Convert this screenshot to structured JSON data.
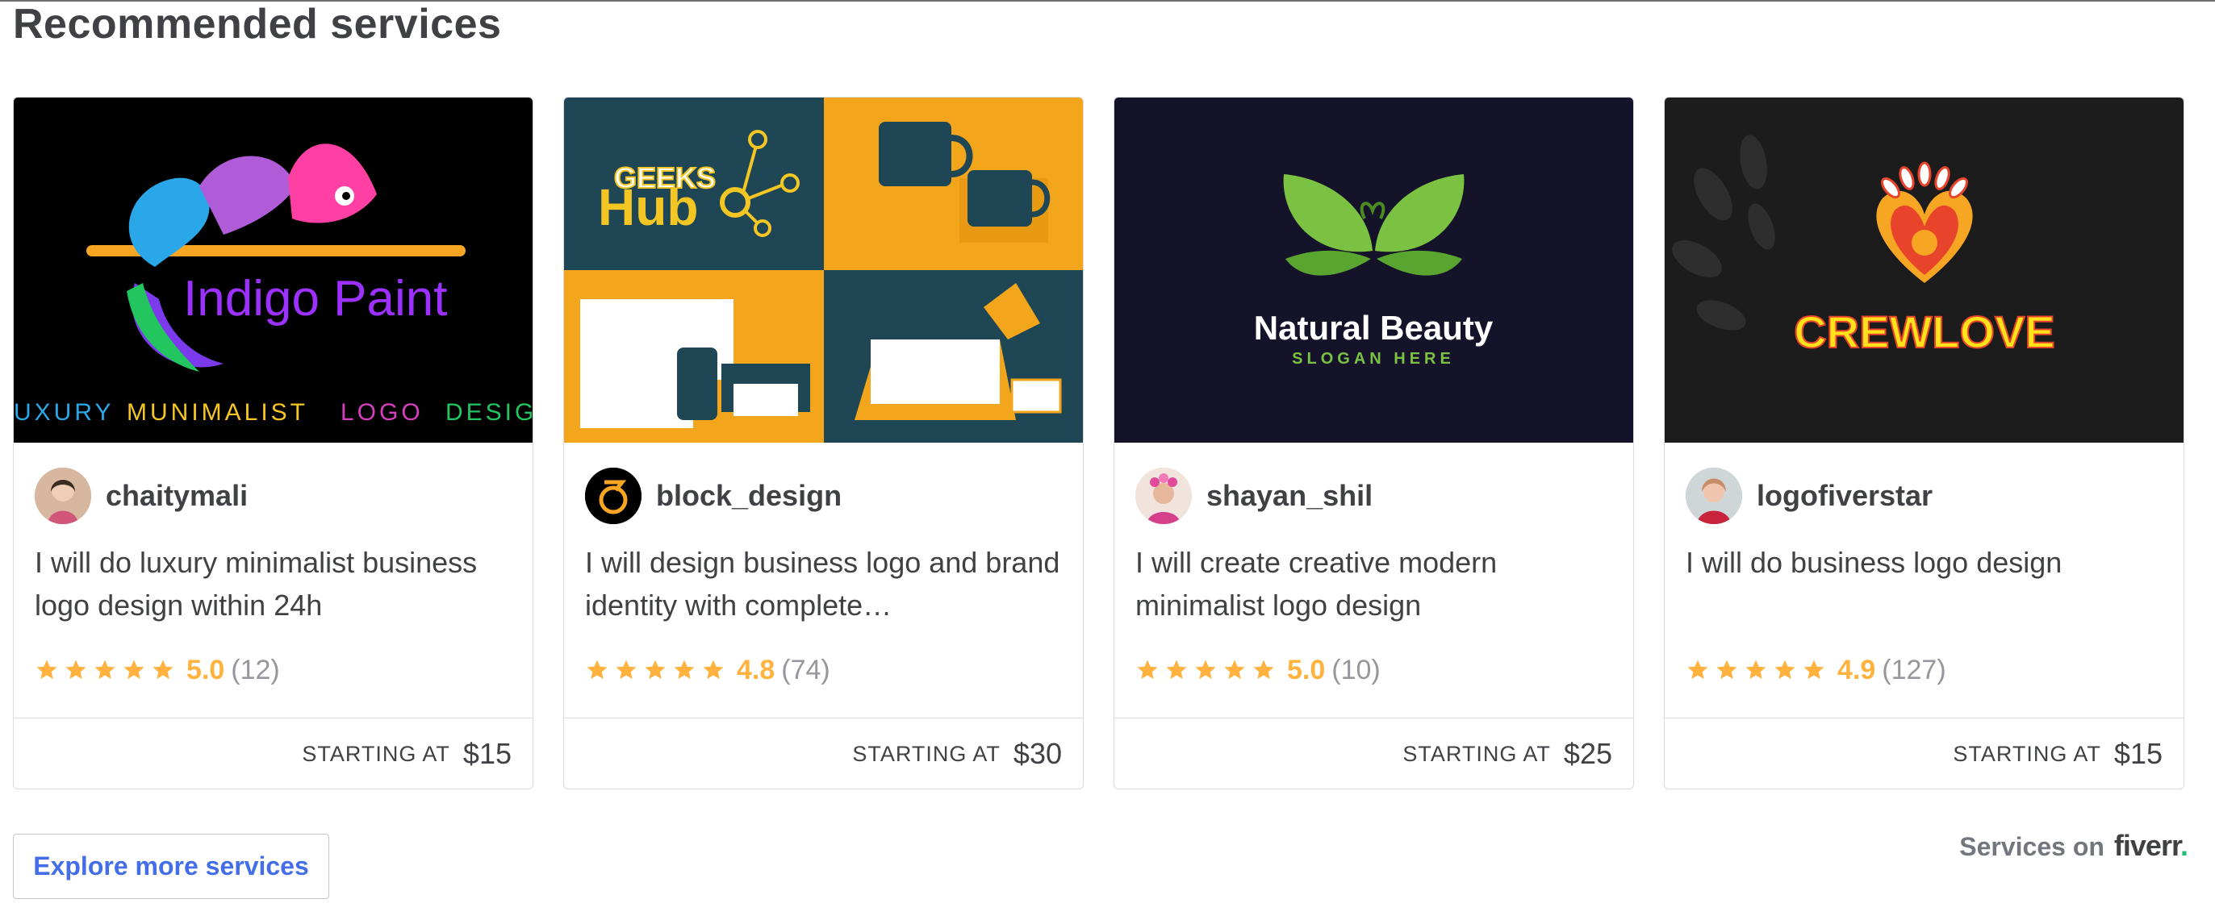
{
  "header": {
    "title": "Recommended services"
  },
  "cards": [
    {
      "thumb": {
        "brand": "Indigo Paint",
        "tagline_words": [
          "UXURY",
          "MUNIMALIST",
          "LOGO",
          "DESIG"
        ]
      },
      "seller": "chaitymali",
      "title": "I will do luxury minimalist business logo design within 24h",
      "rating": "5.0",
      "reviews": "(12)",
      "starting_at": "STARTING AT",
      "price": "$15"
    },
    {
      "thumb": {
        "brand_top": "GEEKS",
        "brand_bottom": "Hub"
      },
      "seller": "block_design",
      "title": "I will design business logo and brand identity with complete…",
      "rating": "4.8",
      "reviews": "(74)",
      "starting_at": "STARTING AT",
      "price": "$30"
    },
    {
      "thumb": {
        "brand": "Natural Beauty",
        "slogan": "SLOGAN HERE"
      },
      "seller": "shayan_shil",
      "title": "I will create creative modern minimalist logo design",
      "rating": "5.0",
      "reviews": "(10)",
      "starting_at": "STARTING AT",
      "price": "$25"
    },
    {
      "thumb": {
        "brand": "CREWLOVE"
      },
      "seller": "logofiverstar",
      "title": "I will do business logo design",
      "rating": "4.9",
      "reviews": "(127)",
      "starting_at": "STARTING AT",
      "price": "$15"
    }
  ],
  "footer": {
    "explore_label": "Explore more services",
    "services_on": "Services on",
    "fiverr": "fiverr",
    "fiverr_dot": "."
  },
  "colors": {
    "accent_link": "#446ee7",
    "star": "#ffb33e",
    "muted": "#95979d",
    "text": "#404145",
    "fiverr_green": "#1dbf73"
  },
  "icons": [
    "star-icon",
    "avatar-icon",
    "fiverr-logo"
  ]
}
